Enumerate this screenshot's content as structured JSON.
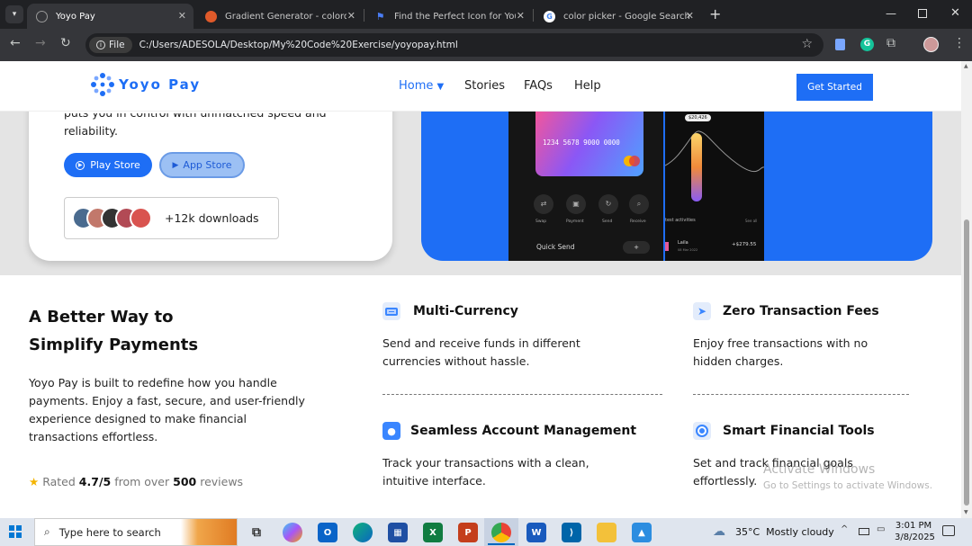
{
  "browser": {
    "tabs": [
      {
        "title": "Yoyo Pay",
        "active": true
      },
      {
        "title": "Gradient Generator - colordesi",
        "active": false
      },
      {
        "title": "Find the Perfect Icon for Your P",
        "active": false
      },
      {
        "title": "color picker - Google Search",
        "active": false
      }
    ],
    "new_tab": "+",
    "file_label": "File",
    "url": "C:/Users/ADESOLA/Desktop/My%20Code%20Exercise/yoyopay.html"
  },
  "site": {
    "logo": "Yoyo Pay",
    "nav": [
      {
        "label": "Home",
        "active": true
      },
      {
        "label": "Stories"
      },
      {
        "label": "FAQs"
      },
      {
        "label": "Help"
      }
    ],
    "cta": "Get Started",
    "accent": "#1e6ef5"
  },
  "hero": {
    "text_line1": "puts you in control with unmatched speed and",
    "text_line2": "reliability.",
    "play_store": "Play Store",
    "app_store": "App Store",
    "downloads": "+12k downloads",
    "phone": {
      "card_number": "1234 5678 9000 0000",
      "quick_send": "Quick Send",
      "actions": [
        "Swap",
        "Payment",
        "Send",
        "Receive"
      ],
      "amount_badge": "$20,426",
      "activities": "test activities",
      "see_all": "See all",
      "contact": "Laila",
      "contact_date": "08 Mar 2022",
      "contact_amount": "+$279.55",
      "add": "+"
    }
  },
  "about": {
    "title_line1": "A Better Way to",
    "title_line2": "Simplify Payments",
    "body": [
      "Yoyo Pay is built to redefine how you handle",
      "payments. Enjoy a fast, secure, and user-friendly",
      "experience designed to make financial",
      "transactions effortless."
    ],
    "rated_prefix": "Rated",
    "rating": "4.7/5",
    "from_over": "from over",
    "reviews_count": "500",
    "reviews_label": "reviews"
  },
  "features": [
    {
      "title": "Multi-Currency",
      "icon": "money-icon",
      "text": [
        "Send and receive funds in different",
        "currencies without hassle."
      ]
    },
    {
      "title": "Zero Transaction Fees",
      "icon": "send-icon",
      "text": [
        "Enjoy free transactions with no",
        "hidden charges."
      ]
    },
    {
      "title": "Seamless Account Management",
      "icon": "user-icon",
      "text": [
        "Track your transactions with a clean,",
        "intuitive interface."
      ]
    },
    {
      "title": "Smart Financial Tools",
      "icon": "target-icon",
      "text": [
        "Set and track financial goals",
        "effortlessly."
      ]
    }
  ],
  "watermark": {
    "line1": "Activate Windows",
    "line2": "Go to Settings to activate Windows."
  },
  "taskbar": {
    "search_placeholder": "Type here to search",
    "weather": "35°C  Mostly cloudy",
    "time": "3:01 PM",
    "date": "3/8/2025"
  }
}
